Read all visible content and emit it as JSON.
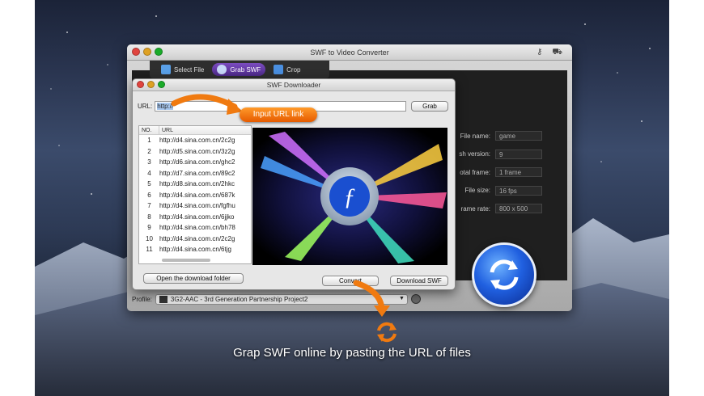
{
  "main_window": {
    "title": "SWF to Video Converter",
    "toolbar": [
      {
        "label": "Select File",
        "icon": "select-file-icon",
        "active": false
      },
      {
        "label": "Grab SWF",
        "icon": "grab-swf-icon",
        "active": true
      },
      {
        "label": "Crop",
        "icon": "crop-icon",
        "active": false
      }
    ],
    "properties": [
      {
        "label": "File name:",
        "value": "game"
      },
      {
        "label": "sh version:",
        "value": "9"
      },
      {
        "label": "otal frame:",
        "value": "1 frame"
      },
      {
        "label": "File size:",
        "value": "16 fps"
      },
      {
        "label": "rame rate:",
        "value": "800 x 500"
      }
    ],
    "profile_label": "Profile:",
    "profile_value": "3G2-AAC - 3rd Generation Partnership Project2"
  },
  "downloader": {
    "title": "SWF Downloader",
    "url_label": "URL:",
    "url_value": "http://",
    "grab_label": "Grab",
    "list_headers": {
      "no": "NO.",
      "url": "URL"
    },
    "list": [
      {
        "no": "1",
        "url": "http://d4.sina.com.cn/2c2g"
      },
      {
        "no": "2",
        "url": "http://d5.sina.com.cn/3z2g"
      },
      {
        "no": "3",
        "url": "http://d6.sina.com.cn/ghc2"
      },
      {
        "no": "4",
        "url": "http://d7.sina.com.cn/89c2"
      },
      {
        "no": "5",
        "url": "http://d8.sina.com.cn/2hkc"
      },
      {
        "no": "6",
        "url": "http://d4.sina.com.cn/687k"
      },
      {
        "no": "7",
        "url": "http://d4.sina.com.cn/fgfhu"
      },
      {
        "no": "8",
        "url": "http://d4.sina.com.cn/6jjko"
      },
      {
        "no": "9",
        "url": "http://d4.sina.com.cn/bh78"
      },
      {
        "no": "10",
        "url": "http://d4.sina.com.cn/2c2g"
      },
      {
        "no": "11",
        "url": "http://d4.sina.com.cn/6tjg"
      }
    ],
    "open_folder_label": "Open the download folder",
    "convert_label": "Convert",
    "download_label": "Download SWF"
  },
  "callout": "Input URL link",
  "caption": "Grap SWF online by pasting the URL of files",
  "colors": {
    "accent_orange": "#f07a10",
    "toolbar_active": "#6a3db0",
    "convert_blue": "#2060e0"
  }
}
